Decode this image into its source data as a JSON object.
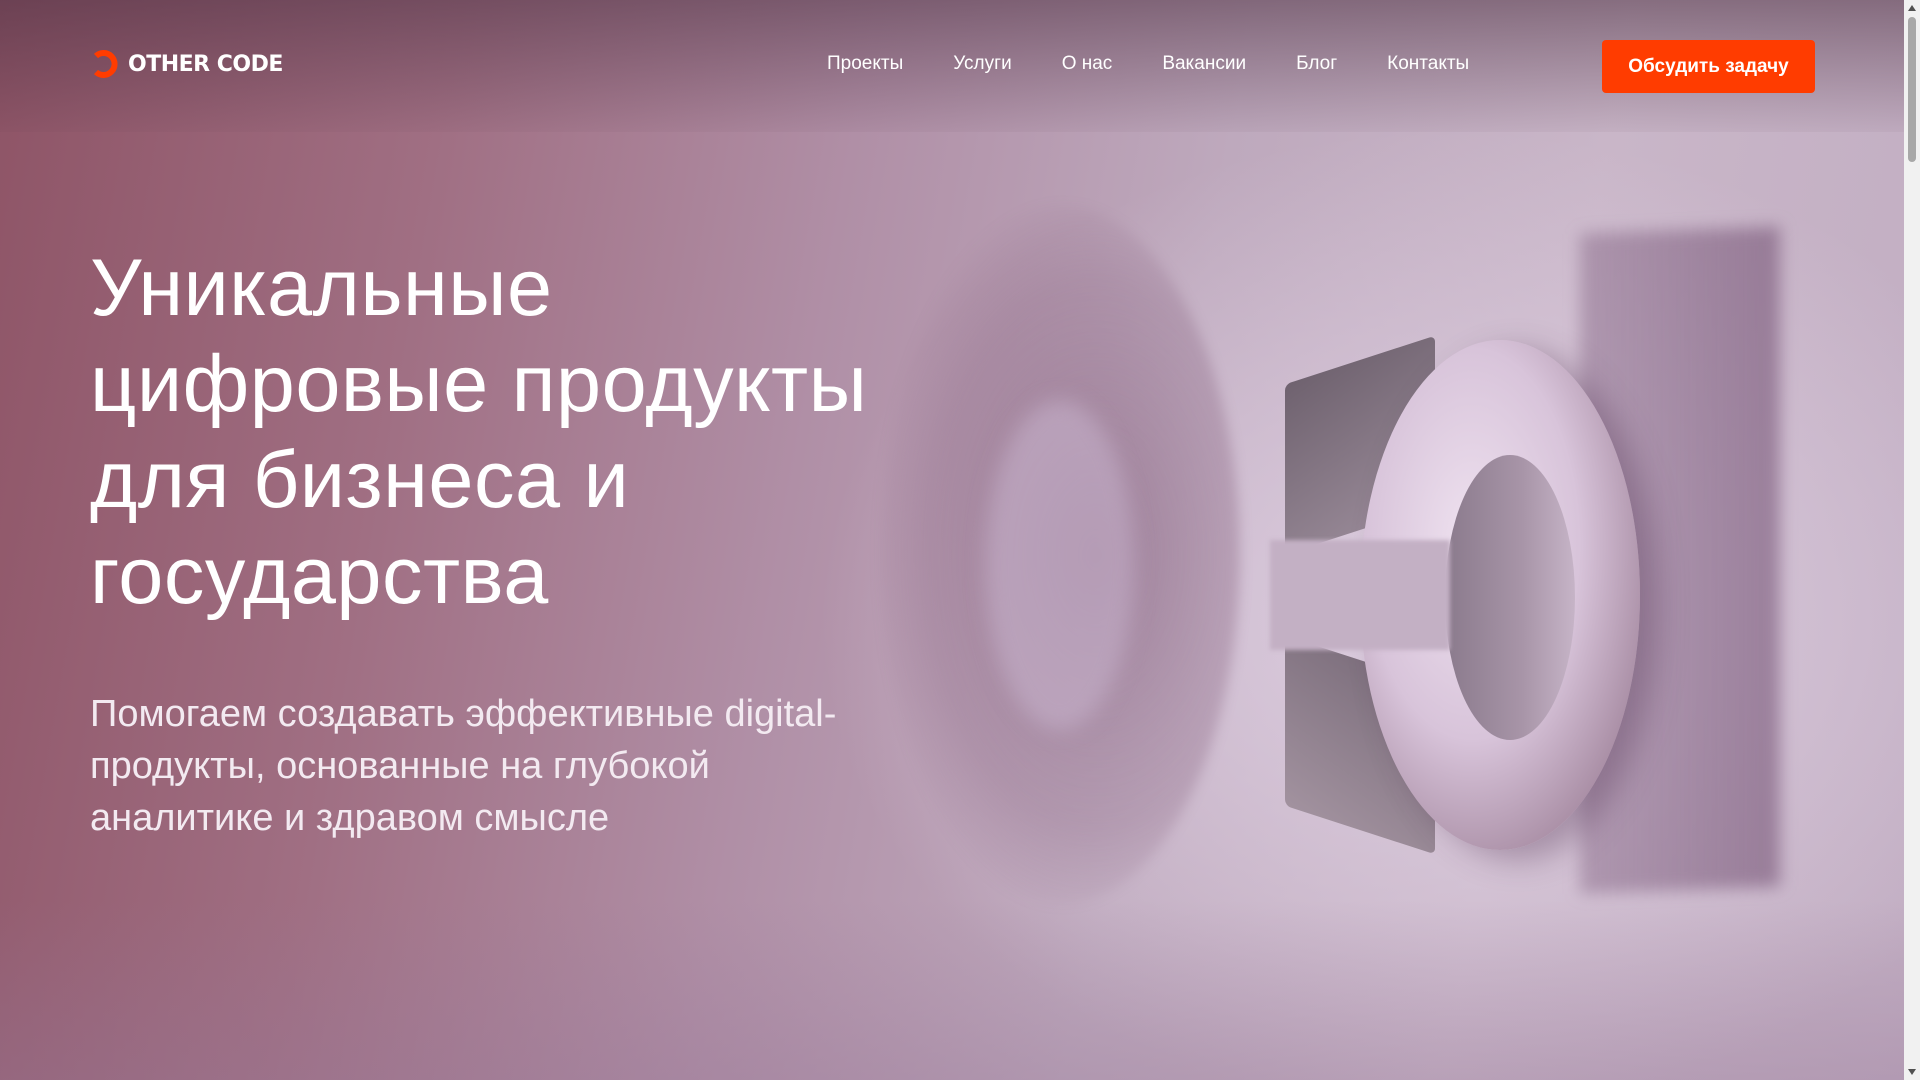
{
  "brand": {
    "name": "OTHER CODE",
    "accent_color": "#ff3c00",
    "logo_icon": "other-code-logo-icon"
  },
  "nav": {
    "items": [
      {
        "label": "Проекты"
      },
      {
        "label": "Услуги"
      },
      {
        "label": "О нас"
      },
      {
        "label": "Вакансии"
      },
      {
        "label": "Блог"
      },
      {
        "label": "Контакты"
      }
    ]
  },
  "cta": {
    "label": "Обсудить задачу"
  },
  "hero": {
    "title_lines": [
      "Уникальные",
      "цифровые продукты",
      "для бизнеса и",
      "государства"
    ],
    "subtitle_lines": [
      "Помогаем создавать эффективные digital-",
      "продукты, основанные на глубокой",
      "аналитике и здравом смысле"
    ]
  },
  "scrollbar": {
    "up_icon": "scroll-up-arrow-icon",
    "down_icon": "scroll-down-arrow-icon"
  }
}
